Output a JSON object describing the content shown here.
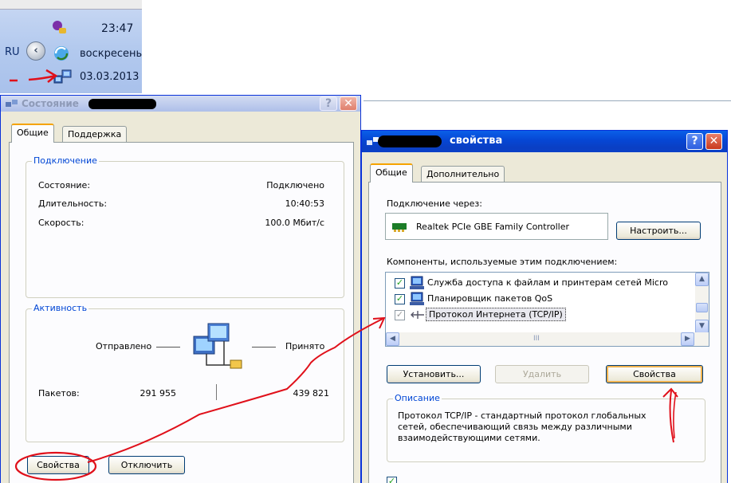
{
  "tray": {
    "lang": "RU",
    "time": "23:47",
    "day": "воскресенье",
    "date": "03.03.2013"
  },
  "status_window": {
    "title": "Состояние",
    "tabs": [
      "Общие",
      "Поддержка"
    ],
    "connection": {
      "legend": "Подключение",
      "rows": [
        {
          "label": "Состояние:",
          "value": "Подключено"
        },
        {
          "label": "Длительность:",
          "value": "10:40:53"
        },
        {
          "label": "Скорость:",
          "value": "100.0 Мбит/с"
        }
      ]
    },
    "activity": {
      "legend": "Активность",
      "sent_label": "Отправлено",
      "received_label": "Принято",
      "packets_label": "Пакетов:",
      "packets_sent": "291 955",
      "packets_received": "439 821"
    },
    "buttons": {
      "properties": "Свойства",
      "disable": "Отключить"
    }
  },
  "props_window": {
    "title": "свойства",
    "tabs": [
      "Общие",
      "Дополнительно"
    ],
    "connect_via_label": "Подключение через:",
    "adapter": "Realtek PCIe GBE Family Controller",
    "configure_button": "Настроить...",
    "components_label": "Компоненты, используемые этим подключением:",
    "components": [
      {
        "label": "Служба доступа к файлам и принтерам сетей Micro",
        "checked": true
      },
      {
        "label": "Планировщик пакетов QoS",
        "checked": true
      },
      {
        "label": "Протокол Интернета (TCP/IP)",
        "checked": true
      }
    ],
    "scroll_mid": "III",
    "buttons": {
      "install": "Установить...",
      "remove": "Удалить",
      "properties": "Свойства"
    },
    "description": {
      "legend": "Описание",
      "text": "Протокол TCP/IP - стандартный протокол глобальных сетей, обеспечивающий связь между различными взаимодействующими сетями."
    }
  },
  "colors": {
    "annotation": "#e0101a",
    "title_bar": "#0a4fd9",
    "dialog_bg": "#ece9d8",
    "legend": "#0046d5"
  }
}
